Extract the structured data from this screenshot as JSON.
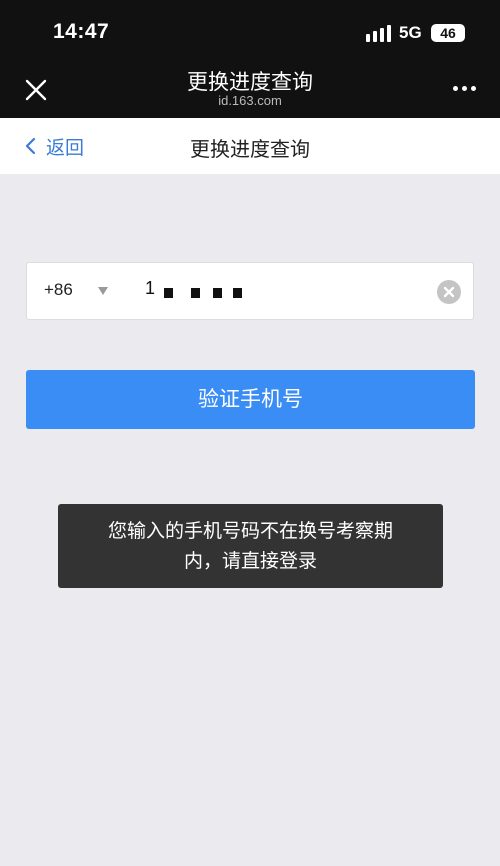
{
  "status_bar": {
    "time": "14:47",
    "network": "5G",
    "battery": "46"
  },
  "browser": {
    "title": "更换进度查询",
    "domain": "id.163.com"
  },
  "nav": {
    "back_label": "返回",
    "title": "更换进度查询"
  },
  "phone": {
    "country_code": "+86",
    "value": "1 ",
    "value_redacted": true
  },
  "verify_button": {
    "label": "验证手机号"
  },
  "toast": {
    "line1": "您输入的手机号码不在换号考察期",
    "line2": "内，请直接登录"
  },
  "colors": {
    "primary": "#3a8df5",
    "link": "#3a7bd5",
    "header_bg": "#111111",
    "page_bg": "#ebebef",
    "toast_bg": "#333333"
  }
}
